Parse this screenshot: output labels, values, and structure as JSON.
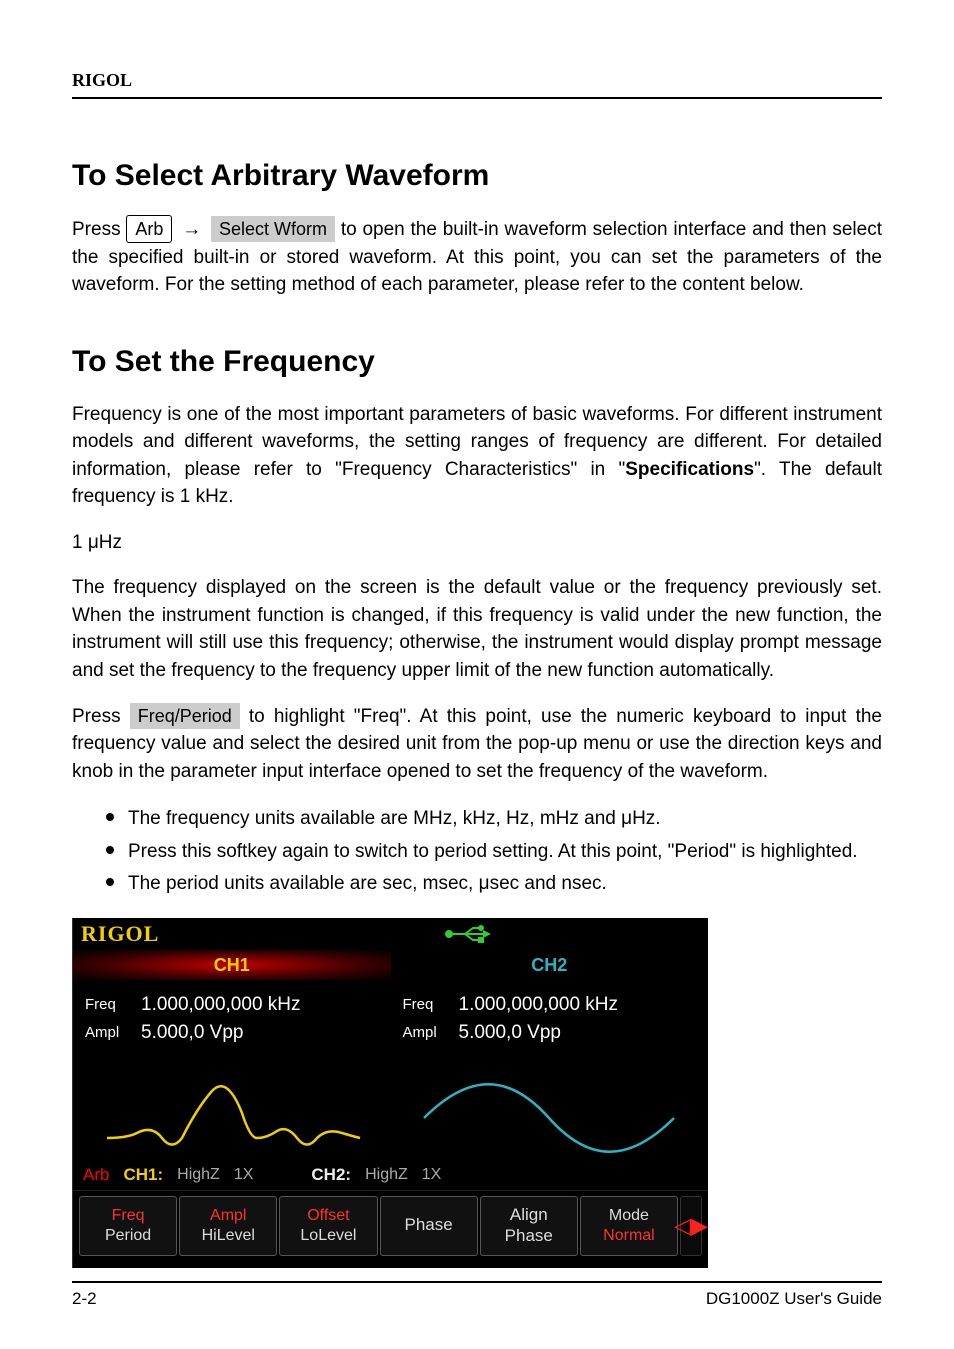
{
  "header": {
    "brand": "RIGOL"
  },
  "section": {
    "title": "To Select Arbitrary Waveform",
    "p1a": "Press ",
    "key1": "Arb",
    "arrow": "→",
    "soft1": "Select Wform",
    "p1b": " to open the built-in waveform selection interface and then select the specified built-in or stored waveform. At this point, you can set the parameters of the waveform. For the setting method of each parameter, please refer to the content below.",
    "subhead": "To Set the Frequency",
    "p2": "Frequency is one of the most important parameters of basic waveforms. For different instrument models and different waveforms, the setting ranges of frequency are different. For detailed information, please refer to \"Frequency Characteristics\" in \"",
    "spec_link": "Specifications",
    "p2b": "\". The default frequency is 1 kHz.",
    "p3a": "The frequency displayed on the screen is the default value or the frequency previously set. When the instrument function is changed, if this frequency is valid under the new function, the instrument will still use this frequency; otherwise, the instrument would display prompt message and set the frequency to the frequency upper limit of the new function automatically.",
    "p4a": "Press ",
    "soft2": "Freq/Period",
    "p4b": " to highlight \"Freq\". At this point, use the numeric keyboard to input the frequency value and select the desired unit from the pop-up menu or use the direction keys and knob in the parameter input interface opened to set the frequency of the waveform.",
    "bullets": [
      "The frequency units available are MHz, kHz, Hz, mHz and μHz.",
      "Press this softkey again to switch to period setting. At this point, \"Period\" is highlighted.",
      "The period units available are sec, msec, μsec and nsec."
    ],
    "resolution": "1 μHz"
  },
  "device": {
    "logo": "RIGOL",
    "ch1_tab": "CH1",
    "ch2_tab": "CH2",
    "ch1": {
      "freq_label": "Freq",
      "freq_val": "1.000,000,000 kHz",
      "ampl_label": "Ampl",
      "ampl_val": "5.000,0 Vpp"
    },
    "ch2": {
      "freq_label": "Freq",
      "freq_val": "1.000,000,000 kHz",
      "ampl_label": "Ampl",
      "ampl_val": "5.000,0 Vpp"
    },
    "status": {
      "arb": "Arb",
      "ch1": "CH1:",
      "ch1_z": "HighZ",
      "ch1_x": "1X",
      "ch2": "CH2:",
      "ch2_z": "HighZ",
      "ch2_x": "1X"
    },
    "soft": [
      {
        "l1": "Freq",
        "l2": "Period"
      },
      {
        "l1": "Ampl",
        "l2": "HiLevel"
      },
      {
        "l1": "Offset",
        "l2": "LoLevel"
      },
      {
        "single": true,
        "l2": "Phase"
      },
      {
        "l1": "Align",
        "l2": "Phase"
      },
      {
        "mode": true,
        "l1": "Mode",
        "l2": "Normal"
      }
    ],
    "nav": "◁▶"
  },
  "footer": {
    "page": "2-2",
    "doc": "DG1000Z User's Guide"
  }
}
